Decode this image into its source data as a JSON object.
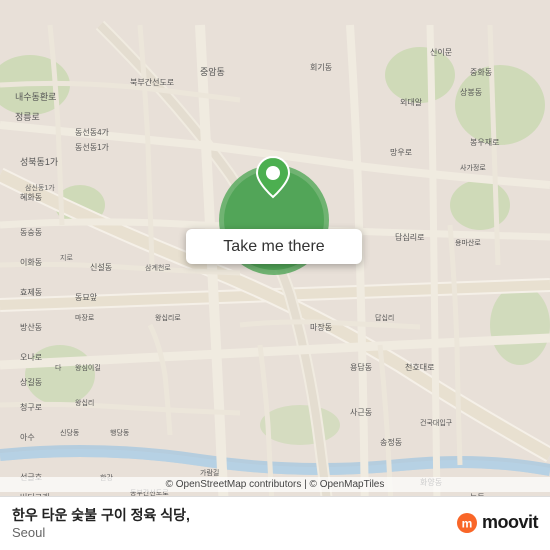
{
  "map": {
    "button_label": "Take me there",
    "attribution": "© OpenStreetMap contributors | © OpenMapTiles",
    "pin_color": "#4CAF50",
    "center_lat": 37.564,
    "center_lng": 127.015
  },
  "bottom_bar": {
    "restaurant_name": "한우 타운 숯불 구이 정육 식당,",
    "location": "Seoul",
    "logo_text": "moovit"
  }
}
